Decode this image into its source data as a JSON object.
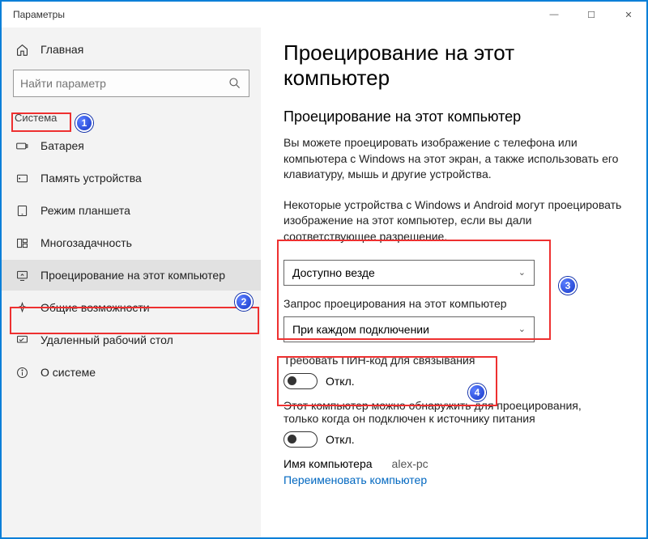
{
  "window": {
    "title": "Параметры"
  },
  "sidebar": {
    "home": "Главная",
    "search_placeholder": "Найти параметр",
    "category": "Система",
    "items": [
      {
        "label": "Батарея",
        "icon": "battery-icon"
      },
      {
        "label": "Память устройства",
        "icon": "storage-icon"
      },
      {
        "label": "Режим планшета",
        "icon": "tablet-icon"
      },
      {
        "label": "Многозадачность",
        "icon": "multitask-icon"
      },
      {
        "label": "Проецирование на этот компьютер",
        "icon": "project-icon",
        "selected": true
      },
      {
        "label": "Общие возможности",
        "icon": "shared-icon"
      },
      {
        "label": "Удаленный рабочий стол",
        "icon": "remote-icon"
      },
      {
        "label": "О системе",
        "icon": "info-icon"
      }
    ]
  },
  "main": {
    "title": "Проецирование на этот компьютер",
    "subtitle": "Проецирование на этот компьютер",
    "desc1": "Вы можете проецировать изображение с телефона или компьютера с Windows на этот экран, а также использовать его клавиатуру, мышь и другие устройства.",
    "desc2": "Некоторые устройства с Windows и Android могут проецировать изображение на этот компьютер, если вы дали соответствующее разрешение.",
    "select1_value": "Доступно везде",
    "select2_label": "Запрос проецирования на этот компьютер",
    "select2_value": "При каждом подключении",
    "toggle1_label": "Требовать ПИН-код для связывания",
    "toggle1_value": "Откл.",
    "toggle2_label": "Этот компьютер можно обнаружить для проецирования, только когда он подключен к источнику питания",
    "toggle2_value": "Откл.",
    "pcname_label": "Имя компьютера",
    "pcname_value": "alex-pc",
    "rename_link": "Переименовать компьютер"
  },
  "annotations": {
    "b1": "1",
    "b2": "2",
    "b3": "3",
    "b4": "4"
  }
}
